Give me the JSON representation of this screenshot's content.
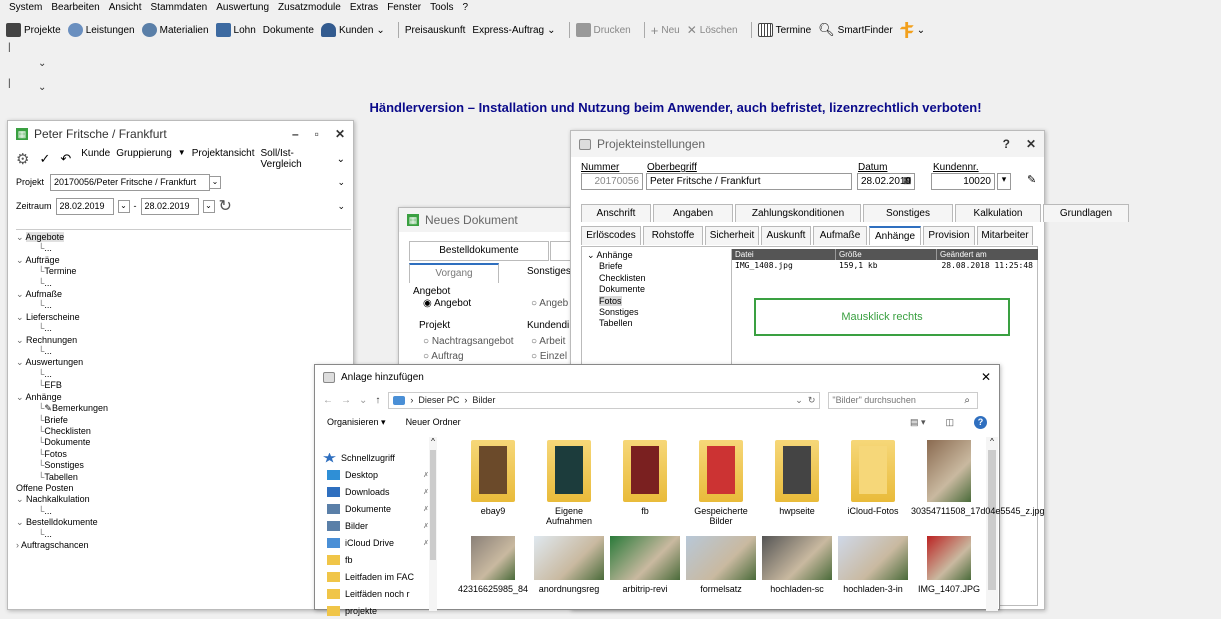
{
  "menu": [
    "System",
    "Bearbeiten",
    "Ansicht",
    "Stammdaten",
    "Auswertung",
    "Zusatzmodule",
    "Extras",
    "Fenster",
    "Tools",
    "?"
  ],
  "toolbar": {
    "projekte": "Projekte",
    "leistungen": "Leistungen",
    "materialien": "Materialien",
    "lohn": "Lohn",
    "dokumente": "Dokumente",
    "kunden": "Kunden",
    "preisauskunft": "Preisauskunft",
    "express": "Express-Auftrag",
    "drucken": "Drucken",
    "neu": "Neu",
    "loeschen": "Löschen",
    "termine": "Termine",
    "smartfinder": "SmartFinder"
  },
  "banner": "Händlerversion – Installation und Nutzung beim Anwender, auch befristet, lizenzrechtlich verboten!",
  "project_window": {
    "title": "Peter Fritsche / Frankfurt",
    "toolbar": [
      "Kunde",
      "Gruppierung",
      "Projektansicht",
      "Soll/Ist-Vergleich"
    ],
    "projekt_label": "Projekt",
    "projekt_value": "20170056/Peter Fritsche / Frankfurt",
    "zeitraum_label": "Zeitraum",
    "date_from": "28.02.2019",
    "date_sep": "-",
    "date_to": "28.02.2019",
    "tree": [
      {
        "t": "Angebote",
        "l": 0,
        "e": true,
        "sel": true
      },
      {
        "t": "...",
        "l": 1
      },
      {
        "t": "Aufträge",
        "l": 0,
        "e": true
      },
      {
        "t": "Termine",
        "l": 1
      },
      {
        "t": "...",
        "l": 1
      },
      {
        "t": "Aufmaße",
        "l": 0,
        "e": true
      },
      {
        "t": "...",
        "l": 1
      },
      {
        "t": "Lieferscheine",
        "l": 0,
        "e": true
      },
      {
        "t": "...",
        "l": 1
      },
      {
        "t": "Rechnungen",
        "l": 0,
        "e": true
      },
      {
        "t": "...",
        "l": 1
      },
      {
        "t": "Auswertungen",
        "l": 0,
        "e": true
      },
      {
        "t": "...",
        "l": 1
      },
      {
        "t": "EFB",
        "l": 1
      },
      {
        "t": "Anhänge",
        "l": 0,
        "e": true
      },
      {
        "t": "Bemerkungen",
        "l": 1,
        "ic": true
      },
      {
        "t": "Briefe",
        "l": 1
      },
      {
        "t": "Checklisten",
        "l": 1
      },
      {
        "t": "Dokumente",
        "l": 1
      },
      {
        "t": "Fotos",
        "l": 1
      },
      {
        "t": "Sonstiges",
        "l": 1
      },
      {
        "t": "Tabellen",
        "l": 1
      },
      {
        "t": "Offene Posten",
        "l": 0
      },
      {
        "t": "Nachkalkulation",
        "l": 0,
        "e": true
      },
      {
        "t": "...",
        "l": 1
      },
      {
        "t": "Bestelldokumente",
        "l": 0,
        "e": true
      },
      {
        "t": "...",
        "l": 1
      },
      {
        "t": "Auftragschancen",
        "l": 0,
        "c": true
      }
    ]
  },
  "neues_dokument": {
    "title": "Neues Dokument",
    "tab_bestell": "Bestelldokumente",
    "tab_vorgang": "Vorgang",
    "tab_sonstiges": "Sonstiges",
    "group_angebot": "Angebot",
    "radio_angebot": "Angebot",
    "radio_angeb2": "Angeb",
    "group_projekt": "Projekt",
    "group_kunden": "Kundendi",
    "radio_nachtrag": "Nachtragsangebot",
    "radio_arbeit": "Arbeit",
    "radio_auftrag": "Auftrag",
    "radio_einzel": "Einzel"
  },
  "projekteinstellungen": {
    "title": "Projekteinstellungen",
    "help": "?",
    "lbl_nummer": "Nummer",
    "lbl_oberbegriff": "Oberbegriff",
    "lbl_datum": "Datum",
    "lbl_kundennr": "Kundennr.",
    "nummer": "20170056",
    "oberbegriff": "Peter Fritsche / Frankfurt",
    "datum": "28.02.2019",
    "kundennr": "10020",
    "tabs_row1": [
      "Anschrift",
      "Angaben",
      "Zahlungskonditionen",
      "Sonstiges",
      "Kalkulation",
      "Grundlagen"
    ],
    "tabs_row2": [
      "Erlöscodes",
      "Rohstoffe",
      "Sicherheit",
      "Auskunft",
      "Aufmaße",
      "Anhänge",
      "Provision",
      "Mitarbeiter"
    ],
    "tree_root": "Anhänge",
    "tree_items": [
      "Briefe",
      "Checklisten",
      "Dokumente",
      "Fotos",
      "Sonstiges",
      "Tabellen"
    ],
    "col_datei": "Datei",
    "col_groesse": "Größe",
    "col_geaendert": "Geändert am",
    "row_datei": "IMG_1408.jpg",
    "row_groesse": "159,1 kb",
    "row_geaendert": "28.08.2018 11:25:48",
    "callout": "Mausklick rechts"
  },
  "anlage": {
    "title": "Anlage hinzufügen",
    "path_root": "Dieser PC",
    "path_folder": "Bilder",
    "search_placeholder": "\"Bilder\" durchsuchen",
    "organisieren": "Organisieren",
    "neuer_ordner": "Neuer Ordner",
    "nav": [
      "Schnellzugriff",
      "Desktop",
      "Downloads",
      "Dokumente",
      "Bilder",
      "iCloud Drive",
      "fb",
      "Leitfaden im FAC",
      "Leitfäden noch r",
      "projekte"
    ],
    "files": [
      "ebay9",
      "Eigene Aufnahmen",
      "fb",
      "Gespeicherte Bilder",
      "hwpseite",
      "iCloud-Fotos",
      "30354711508_17d04e5545_z.jpg"
    ],
    "files_row2": [
      "42316625985_84",
      "anordnungsreg",
      "arbitrip-revi",
      "formelsatz",
      "hochladen-sc",
      "hochladen-3-in",
      "IMG_1407.JPG"
    ]
  },
  "colors": {
    "banner": "#0a0a8a",
    "accent_green": "#3aa041",
    "tab_active": "#2f6fbf"
  }
}
